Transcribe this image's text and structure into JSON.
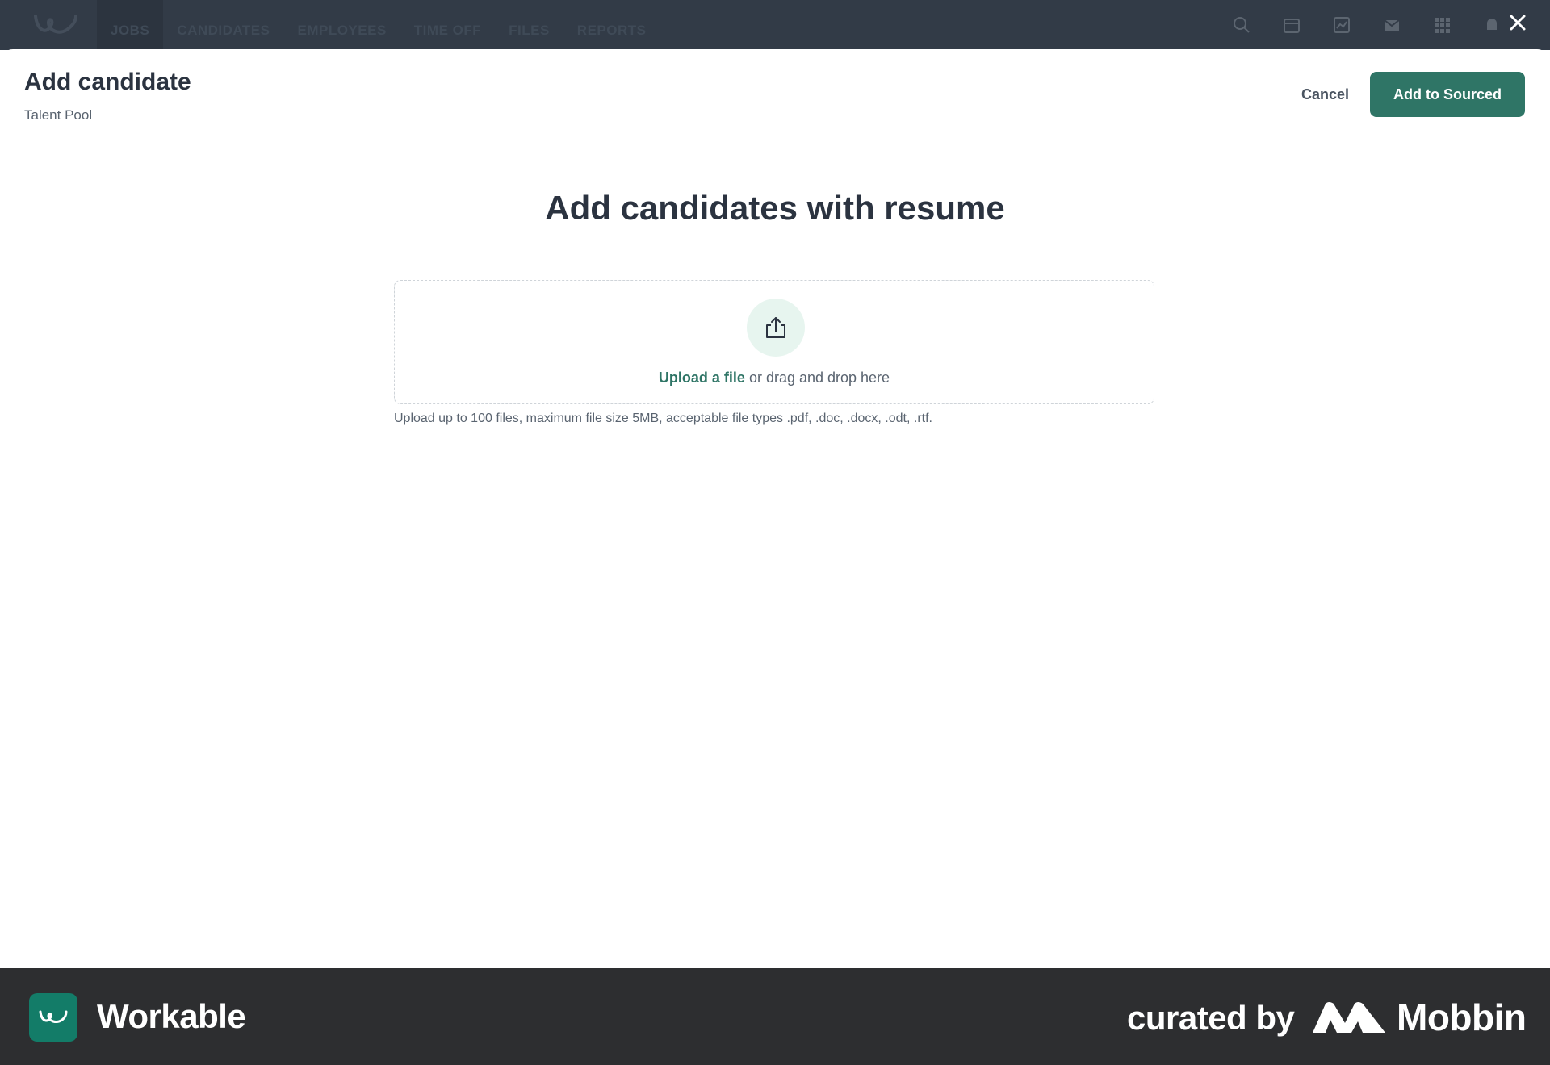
{
  "nav": {
    "items": [
      "JOBS",
      "CANDIDATES",
      "EMPLOYEES",
      "TIME OFF",
      "FILES",
      "REPORTS"
    ],
    "icons": [
      "search-icon",
      "calendar-icon",
      "chart-icon",
      "mail-icon",
      "apps-grid-icon",
      "notification-icon"
    ]
  },
  "modal": {
    "title": "Add candidate",
    "subtitle": "Talent Pool",
    "cancel_label": "Cancel",
    "primary_label": "Add to Sourced"
  },
  "upload": {
    "heading": "Add candidates with resume",
    "link_text": "Upload a file",
    "drop_text": " or drag and drop here",
    "help_text": "Upload up to 100 files, maximum file size 5MB, acceptable file types .pdf, .doc, .docx, .odt, .rtf."
  },
  "footer": {
    "brand": "Workable",
    "curated": "curated by",
    "mobbin": "Mobbin"
  },
  "colors": {
    "accent": "#2f7566",
    "nav_bg": "#323b47",
    "footer_bg": "#2d2e30",
    "brand_badge": "#137c68"
  }
}
